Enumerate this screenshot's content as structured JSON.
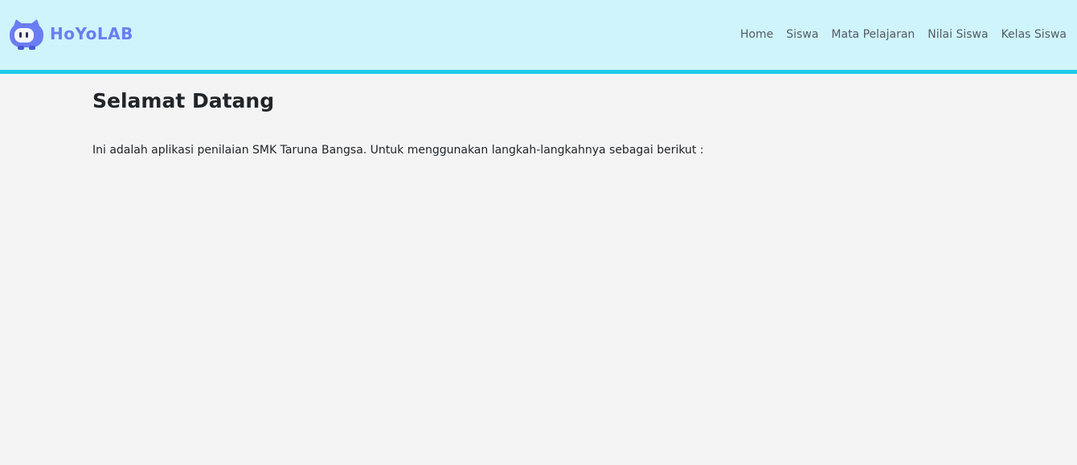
{
  "header": {
    "brand": {
      "logo_icon": "hoyolab-robot-icon",
      "text": "HoYoLAB",
      "color": "#6b7df2"
    },
    "background": "#cff4fc",
    "border_color": "#1ecbe9",
    "nav": [
      {
        "label": "Home"
      },
      {
        "label": "Siswa"
      },
      {
        "label": "Mata Pelajaran"
      },
      {
        "label": "Nilai Siswa"
      },
      {
        "label": "Kelas Siswa"
      }
    ]
  },
  "main": {
    "title": "Selamat Datang",
    "intro": "Ini adalah aplikasi penilaian SMK Taruna Bangsa. Untuk menggunakan langkah-langkahnya sebagai berikut :"
  },
  "page_background": "#f4f4f4"
}
